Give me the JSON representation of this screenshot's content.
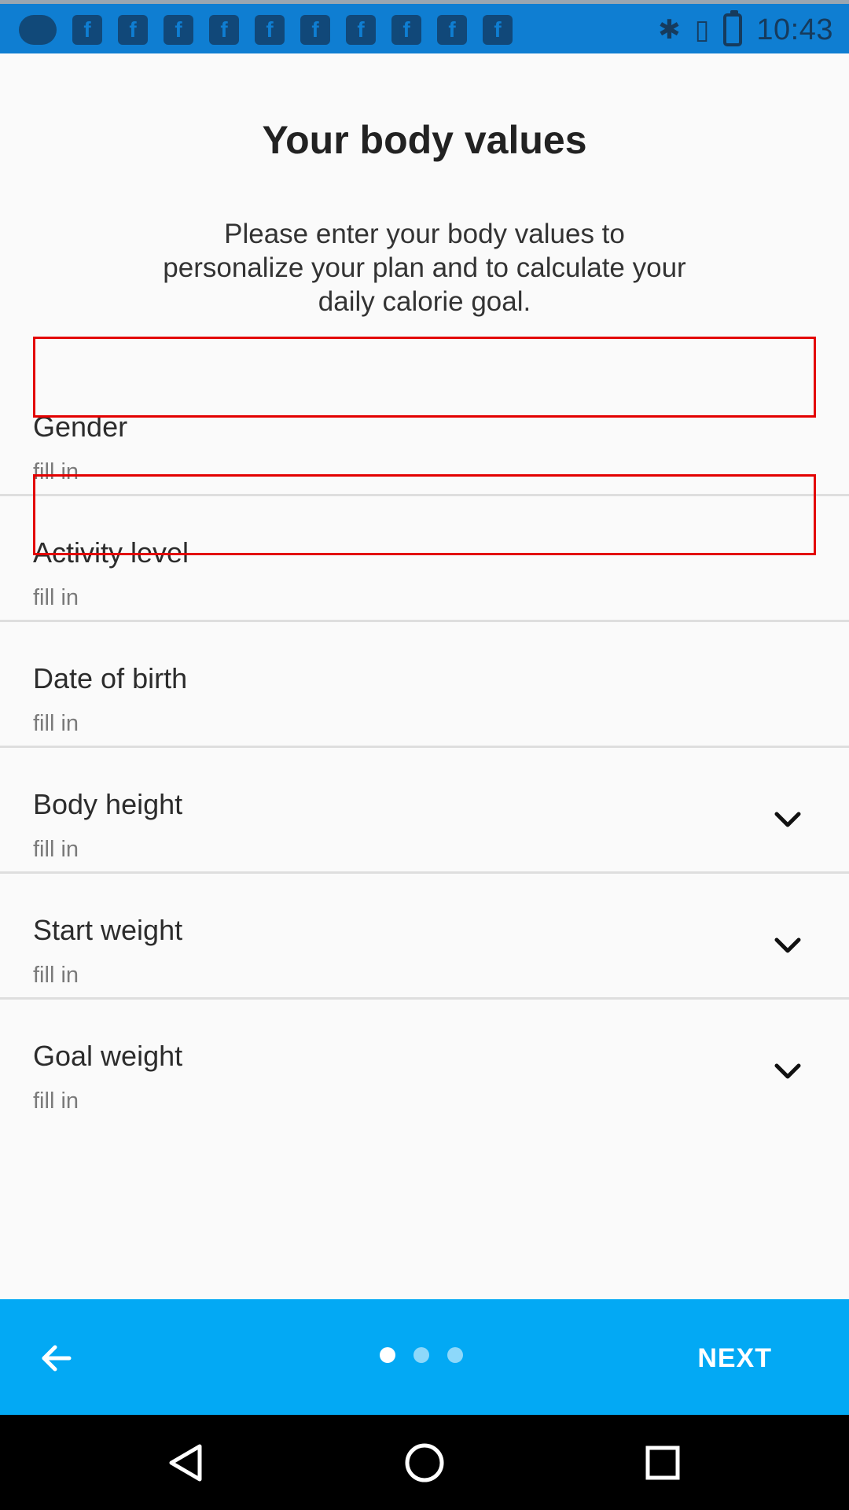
{
  "status_bar": {
    "time": "10:43",
    "notification_icons": [
      "chat-icon",
      "facebook-icon",
      "facebook-icon",
      "facebook-icon",
      "facebook-icon",
      "facebook-icon",
      "facebook-icon",
      "facebook-icon",
      "facebook-icon",
      "facebook-icon",
      "facebook-icon"
    ],
    "system_icons": [
      "bluetooth-icon",
      "vibrate-icon",
      "battery-icon"
    ],
    "background_color": "#0f7ed2"
  },
  "header": {
    "title": "Your body values",
    "subtitle": "Please enter your body values to personalize your plan and to calculate your daily calorie goal."
  },
  "fields": [
    {
      "label": "Gender",
      "value": "fill in",
      "has_dropdown": false
    },
    {
      "label": "Activity level",
      "value": "fill in",
      "has_dropdown": false
    },
    {
      "label": "Date of birth",
      "value": "fill in",
      "has_dropdown": false
    },
    {
      "label": "Body height",
      "value": "fill in",
      "has_dropdown": true
    },
    {
      "label": "Start weight",
      "value": "fill in",
      "has_dropdown": true
    },
    {
      "label": "Goal weight",
      "value": "fill in",
      "has_dropdown": true
    }
  ],
  "bottom_bar": {
    "next_label": "NEXT",
    "back_icon": "arrow-back-icon",
    "page_count": 3,
    "active_page": 1,
    "background_color": "#03a9f4"
  },
  "android_nav": {
    "icons": [
      "back-triangle-icon",
      "home-circle-icon",
      "recents-square-icon"
    ]
  },
  "colors": {
    "accent": "#03a9f4",
    "highlight": "#e30000",
    "background": "#fafafa"
  }
}
